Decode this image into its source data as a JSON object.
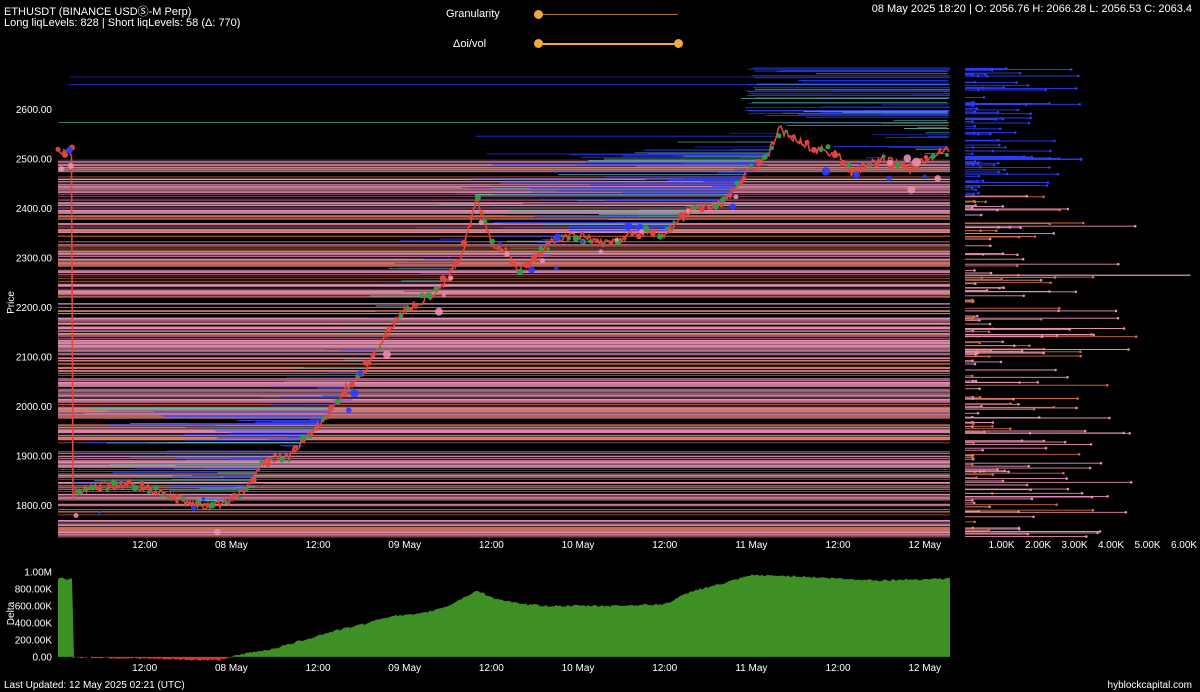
{
  "header": {
    "symbol": "ETHUSDT (BINANCE USDⓈ-M Perp)",
    "liq_levels": "Long liqLevels: 828 | Short liqLevels: 58 (Δ: 770)",
    "ohlc": "08 May 2025 18:20 | O: 2056.76 H: 2066.28 L: 2056.53 C: 2063.4"
  },
  "controls": {
    "granularity_label": "Granularity",
    "granularity_value": 0.0,
    "doi_vol_label": "Δoi/vol",
    "doi_vol_range": [
      0.0,
      1.0
    ]
  },
  "footer": {
    "last_updated": "Last Updated: 12 May 2025 02:21 (UTC)",
    "brand": "hyblockcapital.com"
  },
  "colors": {
    "price_up": "#2e9e45",
    "price_down": "#e0473a",
    "long_liq": "#e58fb3",
    "long_liq_alt": "#d46a3c",
    "short_liq": "#2a3cff",
    "short_liq_alt": "#5fb8a0",
    "delta_pos": "#3e8f24",
    "delta_neg": "#e0332a",
    "accent": "#f5a742"
  },
  "chart_data": [
    {
      "type": "line",
      "name": "price",
      "ylabel": "Price",
      "xlabel": "",
      "x_ticks": [
        "12:00",
        "08 May",
        "12:00",
        "09 May",
        "12:00",
        "10 May",
        "12:00",
        "11 May",
        "12:00",
        "12 May"
      ],
      "y_ticks": [
        "1800.00",
        "1900.00",
        "2000.00",
        "2100.00",
        "2200.00",
        "2300.00",
        "2400.00",
        "2500.00",
        "2600.00"
      ],
      "ylim": [
        1730,
        2690
      ],
      "x": [
        "07 May 02:00",
        "07 May 06:00",
        "07 May 10:00",
        "07 May 14:00",
        "07 May 18:00",
        "07 May 20:00",
        "07 May 22:00",
        "08 May 00:00",
        "08 May 02:00",
        "08 May 04:00",
        "08 May 06:00",
        "08 May 08:00",
        "08 May 10:00",
        "08 May 12:00",
        "08 May 14:00",
        "08 May 16:00",
        "08 May 18:00",
        "08 May 20:00",
        "08 May 22:00",
        "09 May 00:00",
        "09 May 02:00",
        "09 May 04:00",
        "09 May 06:00",
        "09 May 08:00",
        "09 May 10:00",
        "09 May 12:00",
        "09 May 14:00",
        "09 May 16:00",
        "09 May 18:00",
        "09 May 20:00",
        "09 May 22:00",
        "10 May 00:00",
        "10 May 04:00",
        "10 May 08:00",
        "10 May 12:00",
        "10 May 16:00",
        "10 May 20:00",
        "11 May 00:00",
        "11 May 02:00",
        "11 May 04:00",
        "11 May 08:00",
        "11 May 12:00",
        "11 May 14:00",
        "11 May 18:00",
        "11 May 22:00",
        "12 May 02:00"
      ],
      "y": [
        1825,
        1838,
        1842,
        1828,
        1808,
        1796,
        1800,
        1812,
        1832,
        1880,
        1895,
        1900,
        1930,
        1960,
        1995,
        2040,
        2063,
        2110,
        2160,
        2195,
        2210,
        2230,
        2260,
        2310,
        2420,
        2330,
        2310,
        2275,
        2300,
        2330,
        2340,
        2345,
        2330,
        2350,
        2350,
        2400,
        2410,
        2480,
        2500,
        2560,
        2525,
        2510,
        2470,
        2500,
        2480,
        2515
      ]
    },
    {
      "type": "bar",
      "name": "liquidation levels",
      "x_ticks": [
        "1.00K",
        "2.00K",
        "3.00K",
        "4.00K",
        "5.00K",
        "6.00K"
      ],
      "xlim": [
        0,
        6300
      ]
    },
    {
      "type": "area",
      "name": "delta",
      "ylabel": "Delta",
      "y_ticks": [
        "0.00",
        "200.00K",
        "400.00K",
        "600.00K",
        "800.00K",
        "1.00M"
      ],
      "ylim": [
        -60000,
        1080000
      ],
      "x_ticks": [
        "12:00",
        "08 May",
        "12:00",
        "09 May",
        "12:00",
        "10 May",
        "12:00",
        "11 May",
        "12:00",
        "12 May"
      ],
      "x": [
        "07 May 02:00",
        "07 May 10:00",
        "07 May 18:00",
        "07 May 22:00",
        "08 May 02:00",
        "08 May 06:00",
        "08 May 10:00",
        "08 May 14:00",
        "08 May 18:00",
        "08 May 22:00",
        "09 May 02:00",
        "09 May 06:00",
        "09 May 10:00",
        "09 May 12:00",
        "09 May 16:00",
        "09 May 20:00",
        "10 May 04:00",
        "10 May 12:00",
        "10 May 16:00",
        "10 May 20:00",
        "11 May 00:00",
        "11 May 06:00",
        "11 May 12:00",
        "11 May 18:00",
        "12 May 02:00"
      ],
      "y": [
        -5000,
        -15000,
        -35000,
        -40000,
        40000,
        100000,
        200000,
        300000,
        380000,
        480000,
        500000,
        600000,
        780000,
        700000,
        620000,
        600000,
        600000,
        620000,
        780000,
        860000,
        960000,
        950000,
        920000,
        900000,
        920000
      ]
    }
  ]
}
